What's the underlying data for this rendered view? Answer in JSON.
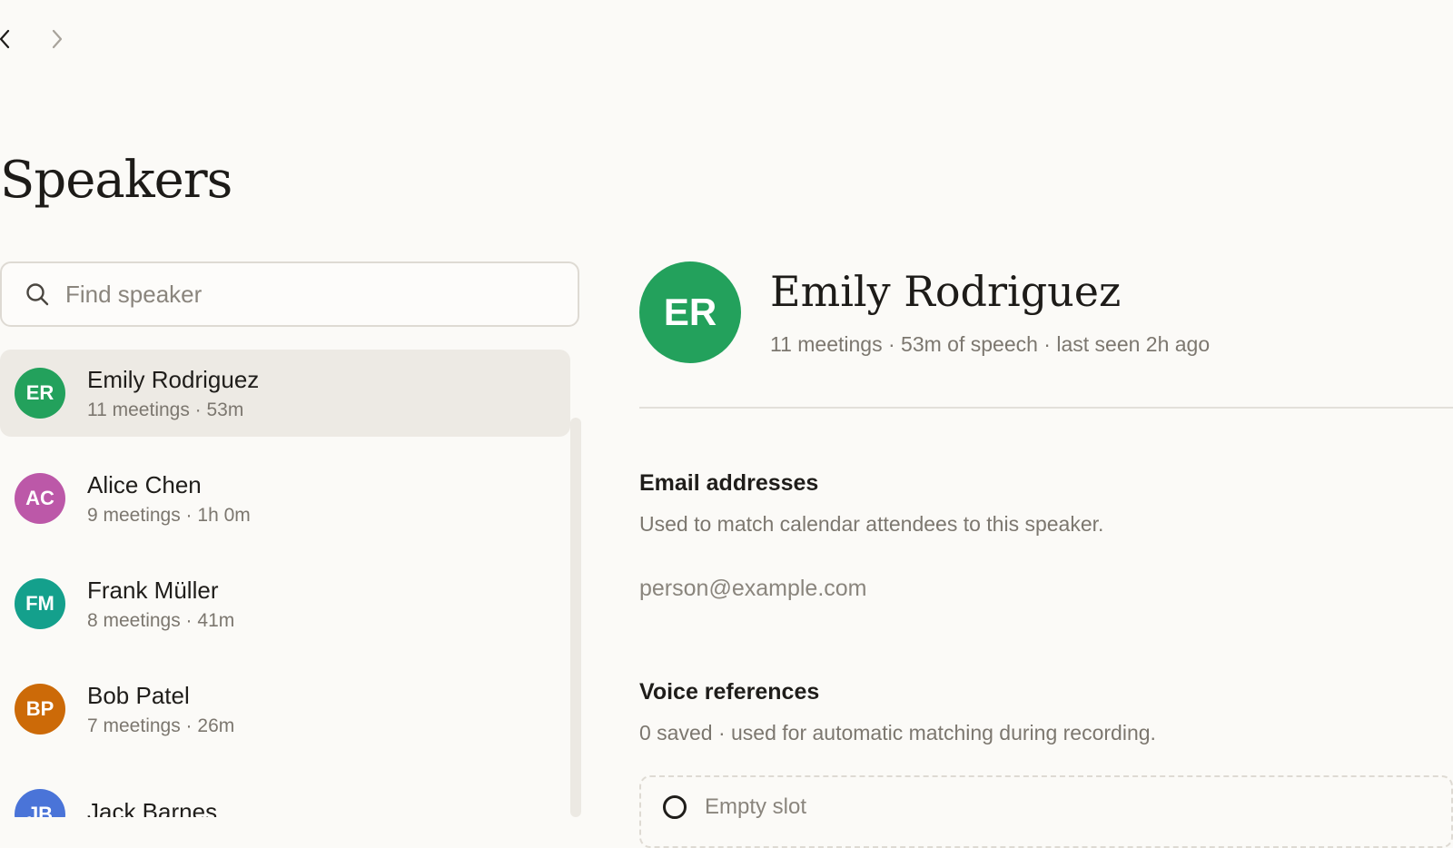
{
  "nav": {
    "back_icon": "chevron-left-icon",
    "forward_icon": "chevron-right-icon"
  },
  "page": {
    "title": "Speakers"
  },
  "search": {
    "placeholder": "Find speaker",
    "value": "",
    "icon": "search-icon"
  },
  "speakers": [
    {
      "initials": "ER",
      "name": "Emily Rodriguez",
      "meta": "11 meetings · 53m",
      "color": "#23a15c",
      "selected": true
    },
    {
      "initials": "AC",
      "name": "Alice Chen",
      "meta": "9 meetings · 1h 0m",
      "color": "#bc58a8",
      "selected": false
    },
    {
      "initials": "FM",
      "name": "Frank Müller",
      "meta": "8 meetings · 41m",
      "color": "#14a08c",
      "selected": false
    },
    {
      "initials": "BP",
      "name": "Bob Patel",
      "meta": "7 meetings · 26m",
      "color": "#cc6a08",
      "selected": false
    },
    {
      "initials": "JB",
      "name": "Jack Barnes",
      "meta": "",
      "color": "#4a74d8",
      "selected": false
    }
  ],
  "detail": {
    "initials": "ER",
    "avatar_color": "#23a15c",
    "name": "Emily Rodriguez",
    "meta": "11 meetings · 53m of speech · last seen 2h ago",
    "email_section": {
      "heading": "Email addresses",
      "description": "Used to match calendar attendees to this speaker.",
      "placeholder": "person@example.com",
      "value": ""
    },
    "voice_section": {
      "heading": "Voice references",
      "description": "0 saved · used for automatic matching during recording.",
      "slot_label": "Empty slot"
    }
  },
  "colors": {
    "background": "#fbfaf7",
    "selected_row": "#edeae4",
    "muted_text": "#7c776f",
    "border": "#dedad3"
  }
}
